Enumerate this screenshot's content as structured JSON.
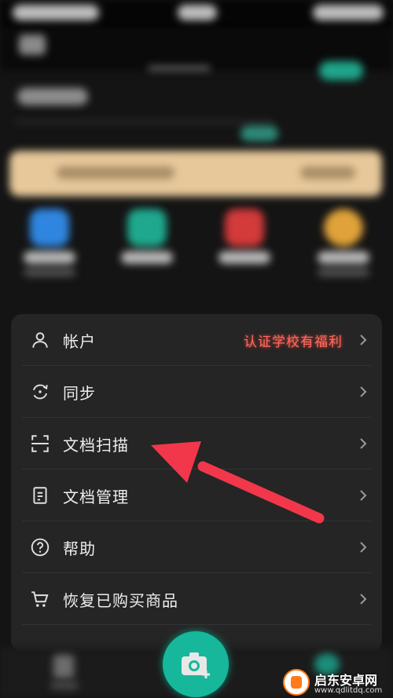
{
  "menu": {
    "items": [
      {
        "label": "帐户",
        "badge": "认证学校有福利",
        "icon": "user-icon"
      },
      {
        "label": "同步",
        "icon": "sync-icon"
      },
      {
        "label": "文档扫描",
        "icon": "scan-icon"
      },
      {
        "label": "文档管理",
        "icon": "document-icon"
      },
      {
        "label": "帮助",
        "icon": "help-icon"
      },
      {
        "label": "恢复已购买商品",
        "icon": "cart-icon"
      }
    ]
  },
  "colors": {
    "background": "#141414",
    "card": "#252525",
    "accent": "#17b79c",
    "badge": "#ff6a5e",
    "arrow": "#f2374b"
  },
  "watermark": {
    "title": "启东安卓网",
    "url": "www.qdlitdq.com"
  }
}
